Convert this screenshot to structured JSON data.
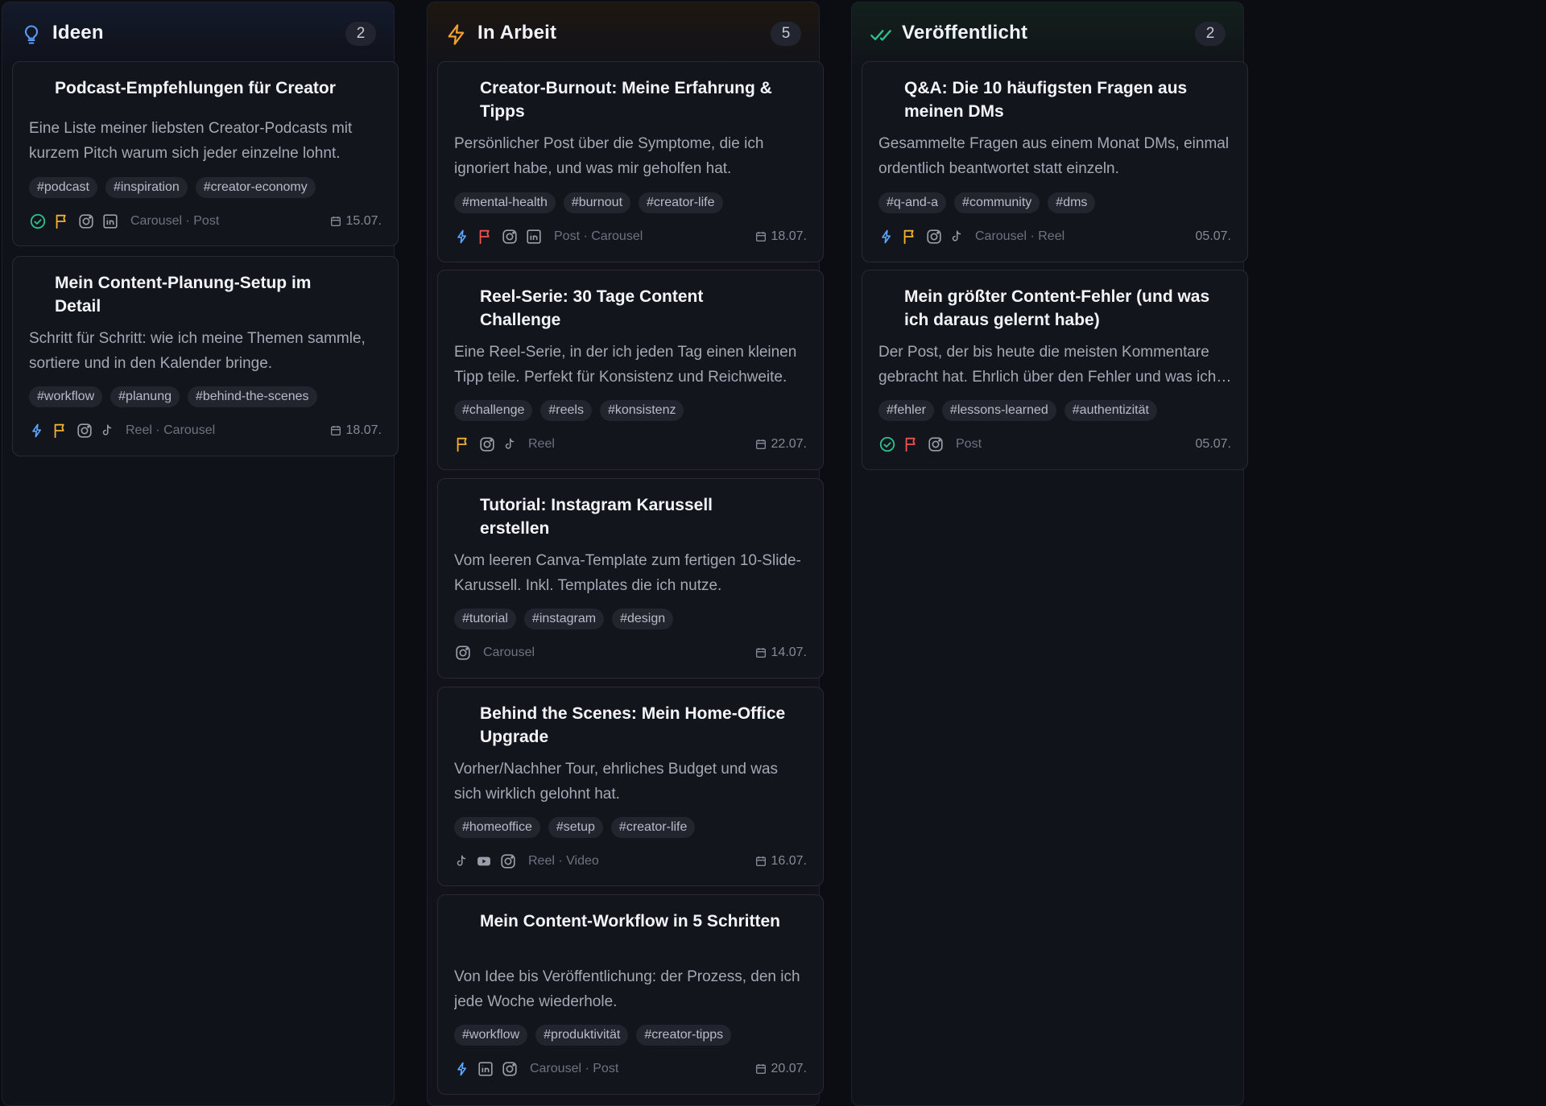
{
  "columns": [
    {
      "title": "Ideen",
      "count": "2",
      "icon": "lightbulb-icon",
      "accent": "#5b9bf5",
      "cards": [
        {
          "title": "Podcast-Empfehlungen für Creator",
          "description": "Eine Liste meiner liebsten Creator-Podcasts mit kurzem Pitch warum sich jeder einzelne lohnt.",
          "tags": [
            "#podcast",
            "#inspiration",
            "#creator-economy"
          ],
          "status_icon": "check-circle-icon",
          "priority_icon": "flag-icon",
          "platforms": [
            "instagram-icon",
            "linkedin-icon"
          ],
          "types": "Carousel · Post",
          "date": "15.07."
        },
        {
          "title": "Mein Content-Planung-Setup im Detail",
          "description": "Schritt für Schritt: wie ich meine Themen sammle, sortiere und in den Kalender bringe.",
          "tags": [
            "#workflow",
            "#planung",
            "#behind-the-scenes"
          ],
          "status_icon": "bolt-icon",
          "priority_icon": "flag-icon",
          "platforms": [
            "instagram-icon",
            "tiktok-icon"
          ],
          "types": "Reel · Carousel",
          "date": "18.07."
        }
      ]
    },
    {
      "title": "In Arbeit",
      "count": "5",
      "icon": "lightning-icon",
      "accent": "#f0a030",
      "cards": [
        {
          "title": "Creator-Burnout: Meine Erfahrung & Tipps",
          "description": "Persönlicher Post über die Symptome, die ich ignoriert habe, und was mir geholfen hat.",
          "tags": [
            "#mental-health",
            "#burnout",
            "#creator-life"
          ],
          "status_icon": "bolt-icon",
          "priority_icon": "flag-icon",
          "platforms": [
            "instagram-icon",
            "linkedin-icon"
          ],
          "types": "Post · Carousel",
          "date": "18.07."
        },
        {
          "title": "Reel-Serie: 30 Tage Content Challenge",
          "description": "Eine Reel-Serie, in der ich jeden Tag einen kleinen Tipp teile. Perfekt für Konsistenz und Reichweite.",
          "tags": [
            "#challenge",
            "#reels",
            "#konsistenz"
          ],
          "status_icon": "",
          "priority_icon": "flag-icon",
          "platforms": [
            "instagram-icon",
            "tiktok-icon"
          ],
          "types": "Reel",
          "date": "22.07."
        },
        {
          "title": "Tutorial: Instagram Karussell erstellen",
          "description": "Vom leeren Canva-Template zum fertigen 10-Slide-Karussell. Inkl. Templates die ich nutze.",
          "tags": [
            "#tutorial",
            "#instagram",
            "#design"
          ],
          "status_icon": "",
          "priority_icon": "",
          "platforms": [
            "instagram-icon"
          ],
          "types": "Carousel",
          "date": "14.07."
        },
        {
          "title": "Behind the Scenes: Mein Home-Office Upgrade",
          "description": "Vorher/Nachher Tour, ehrliches Budget und was sich wirklich gelohnt hat.",
          "tags": [
            "#homeoffice",
            "#setup",
            "#creator-life"
          ],
          "status_icon": "",
          "priority_icon": "",
          "platforms": [
            "tiktok-icon",
            "youtube-icon",
            "instagram-icon"
          ],
          "types": "Reel · Video",
          "date": "16.07."
        },
        {
          "title": "Mein Content-Workflow in 5 Schritten",
          "description": "Von Idee bis Veröffentlichung: der Prozess, den ich jede Woche wiederhole.",
          "tags": [
            "#workflow",
            "#produktivität",
            "#creator-tipps"
          ],
          "status_icon": "bolt-icon",
          "priority_icon": "",
          "platforms": [
            "linkedin-icon",
            "instagram-icon"
          ],
          "types": "Carousel · Post",
          "date": "20.07."
        }
      ]
    },
    {
      "title": "Veröffentlicht",
      "count": "2",
      "icon": "double-check-icon",
      "accent": "#2fbf8f",
      "cards": [
        {
          "title": "Q&A: Die 10 häufigsten Fragen aus meinen DMs",
          "description": "Gesammelte Fragen aus einem Monat DMs, einmal ordentlich beantwortet statt einzeln.",
          "tags": [
            "#q-and-a",
            "#community",
            "#dms"
          ],
          "status_icon": "bolt-icon",
          "priority_icon": "flag-icon",
          "platforms": [
            "instagram-icon",
            "tiktok-icon"
          ],
          "types": "Carousel · Reel",
          "date": "05.07."
        },
        {
          "title": "Mein größter Content-Fehler (und was ich daraus gelernt habe)",
          "description": "Der Post, der bis heute die meisten Kommentare gebracht hat. Ehrlich über den Fehler und was ich daraus mitnehme.",
          "tags": [
            "#fehler",
            "#lessons-learned",
            "#authentizität"
          ],
          "status_icon": "check-circle-icon",
          "priority_icon": "flag-icon",
          "platforms": [
            "instagram-icon"
          ],
          "types": "Post",
          "date": "05.07."
        }
      ]
    }
  ],
  "colors": {
    "flag_yellow": "#f2b233",
    "flag_red": "#ef5350",
    "bolt_blue": "#5aa8ff",
    "check_green": "#2fbf8f"
  }
}
